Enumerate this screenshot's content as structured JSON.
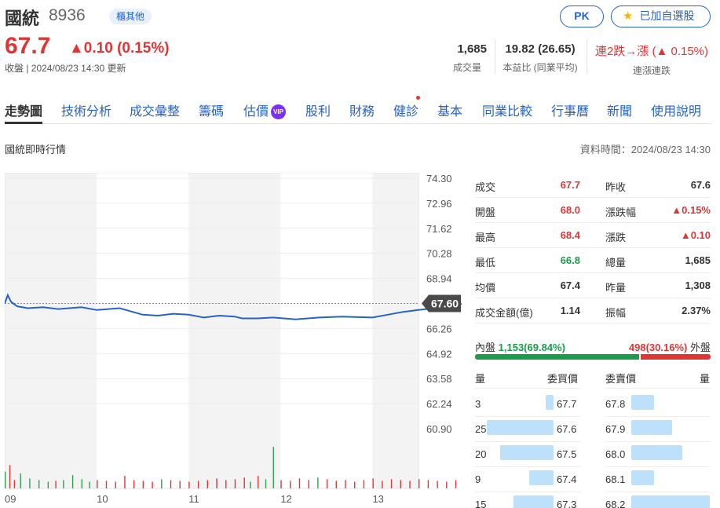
{
  "stock": {
    "name": "國統",
    "code": "8936",
    "market_tag": "櫃其他",
    "price": "67.7",
    "change": "▲0.10 (0.15%)",
    "status": "收盤 | 2024/08/23 14:30 更新",
    "color_up": "#e03535",
    "color_down": "#1a9c4a",
    "accent": "#2563c9"
  },
  "actions": {
    "pk_label": "PK",
    "fav_icon": "star-icon",
    "fav_label": "已加自選股"
  },
  "stats": [
    {
      "value": "1,685",
      "label": "成交量"
    },
    {
      "value": "19.82 (26.65)",
      "label": "本益比 (同業平均)"
    },
    {
      "value": "連2跌→漲 (▲ 0.15%)",
      "label": "連漲連跌"
    }
  ],
  "tabs": [
    "走勢圖",
    "技術分析",
    "成交彙整",
    "籌碼",
    "估價",
    "股利",
    "財務",
    "健診",
    "基本",
    "同業比較",
    "行事曆",
    "新聞",
    "使用說明"
  ],
  "vip_badge": "VIP",
  "section": {
    "title": "國統即時行情",
    "data_time": "資料時間：2024/08/23 14:30"
  },
  "chart_data": {
    "type": "line",
    "x_ticks": [
      "09",
      "10",
      "11",
      "12",
      "13"
    ],
    "y_ticks": [
      "74.30",
      "72.96",
      "71.62",
      "70.28",
      "68.94",
      "67.60",
      "66.26",
      "64.92",
      "63.58",
      "62.24",
      "60.90"
    ],
    "ylim": [
      60.9,
      74.3
    ],
    "ref_price": 67.6,
    "last_label": "67.60",
    "color": "#2563c9",
    "x_range": [
      0,
      270
    ],
    "price_series": [
      [
        0,
        67.6
      ],
      [
        2,
        68.05
      ],
      [
        4,
        67.7
      ],
      [
        8,
        67.45
      ],
      [
        15,
        67.35
      ],
      [
        25,
        67.4
      ],
      [
        35,
        67.3
      ],
      [
        50,
        67.4
      ],
      [
        60,
        67.25
      ],
      [
        75,
        67.35
      ],
      [
        90,
        67.0
      ],
      [
        100,
        66.95
      ],
      [
        110,
        67.05
      ],
      [
        120,
        67.0
      ],
      [
        130,
        66.85
      ],
      [
        140,
        66.95
      ],
      [
        150,
        66.9
      ],
      [
        155,
        66.8
      ],
      [
        165,
        66.8
      ],
      [
        175,
        66.85
      ],
      [
        190,
        66.75
      ],
      [
        205,
        66.85
      ],
      [
        220,
        66.9
      ],
      [
        240,
        66.85
      ],
      [
        250,
        67.0
      ],
      [
        260,
        67.15
      ],
      [
        270,
        67.25
      ],
      [
        280,
        67.35
      ],
      [
        290,
        67.45
      ],
      [
        300,
        67.6
      ],
      [
        310,
        67.5
      ],
      [
        320,
        67.55
      ],
      [
        330,
        67.7
      ],
      [
        345,
        67.8
      ],
      [
        358,
        67.7
      ],
      [
        362,
        67.95
      ],
      [
        370,
        67.75
      ],
      [
        385,
        67.55
      ],
      [
        400,
        67.6
      ],
      [
        420,
        67.55
      ],
      [
        440,
        67.65
      ],
      [
        450,
        67.65
      ],
      [
        455,
        67.75
      ],
      [
        470,
        67.75
      ],
      [
        480,
        67.6
      ],
      [
        490,
        67.55
      ],
      [
        500,
        67.6
      ],
      [
        515,
        67.55
      ],
      [
        527,
        67.6
      ],
      [
        540,
        67.6
      ]
    ],
    "volume_series": [
      [
        0,
        20
      ],
      [
        3,
        28
      ],
      [
        6,
        10
      ],
      [
        10,
        18
      ],
      [
        16,
        12
      ],
      [
        22,
        10
      ],
      [
        28,
        8
      ],
      [
        33,
        9
      ],
      [
        38,
        10
      ],
      [
        44,
        16
      ],
      [
        50,
        11
      ],
      [
        55,
        8
      ],
      [
        60,
        10
      ],
      [
        66,
        9
      ],
      [
        72,
        8
      ],
      [
        78,
        15
      ],
      [
        84,
        10
      ],
      [
        90,
        9
      ],
      [
        96,
        8
      ],
      [
        102,
        11
      ],
      [
        108,
        10
      ],
      [
        114,
        9
      ],
      [
        120,
        8
      ],
      [
        126,
        9
      ],
      [
        132,
        10
      ],
      [
        138,
        12
      ],
      [
        144,
        10
      ],
      [
        150,
        11
      ],
      [
        156,
        13
      ],
      [
        160,
        8
      ],
      [
        165,
        15
      ],
      [
        170,
        11
      ],
      [
        175,
        50
      ],
      [
        180,
        10
      ],
      [
        186,
        9
      ],
      [
        192,
        12
      ],
      [
        198,
        10
      ],
      [
        204,
        13
      ],
      [
        210,
        11
      ],
      [
        216,
        9
      ],
      [
        222,
        10
      ],
      [
        228,
        8
      ],
      [
        234,
        10
      ],
      [
        240,
        12
      ],
      [
        246,
        9
      ],
      [
        252,
        11
      ],
      [
        258,
        10
      ],
      [
        264,
        9
      ],
      [
        270,
        11
      ],
      [
        276,
        10
      ],
      [
        282,
        9
      ],
      [
        288,
        8
      ],
      [
        294,
        10
      ],
      [
        300,
        11
      ],
      [
        306,
        10
      ],
      [
        312,
        9
      ],
      [
        318,
        10
      ],
      [
        324,
        8
      ],
      [
        330,
        9
      ],
      [
        336,
        10
      ],
      [
        342,
        13
      ],
      [
        348,
        10
      ],
      [
        354,
        14
      ],
      [
        360,
        30
      ],
      [
        364,
        18
      ],
      [
        370,
        10
      ],
      [
        376,
        9
      ],
      [
        382,
        10
      ],
      [
        388,
        11
      ],
      [
        394,
        10
      ],
      [
        400,
        8
      ],
      [
        406,
        9
      ],
      [
        412,
        10
      ],
      [
        418,
        9
      ],
      [
        424,
        8
      ],
      [
        430,
        11
      ],
      [
        436,
        9
      ],
      [
        442,
        10
      ],
      [
        448,
        8
      ],
      [
        454,
        9
      ],
      [
        460,
        10
      ],
      [
        466,
        9
      ],
      [
        472,
        8
      ],
      [
        478,
        11
      ],
      [
        484,
        10
      ],
      [
        490,
        9
      ],
      [
        496,
        11
      ],
      [
        502,
        13
      ],
      [
        508,
        10
      ],
      [
        514,
        12
      ],
      [
        520,
        16
      ],
      [
        527,
        65
      ]
    ]
  },
  "quote": [
    {
      "l": "成交",
      "v": "67.7",
      "c": "red",
      "l2": "昨收",
      "v2": "67.6",
      "c2": "dark"
    },
    {
      "l": "開盤",
      "v": "68.0",
      "c": "red",
      "l2": "漲跌幅",
      "v2": "▲0.15%",
      "c2": "red"
    },
    {
      "l": "最高",
      "v": "68.4",
      "c": "red",
      "l2": "漲跌",
      "v2": "▲0.10",
      "c2": "red"
    },
    {
      "l": "最低",
      "v": "66.8",
      "c": "green",
      "l2": "總量",
      "v2": "1,685",
      "c2": "dark"
    },
    {
      "l": "均價",
      "v": "67.4",
      "c": "dark",
      "l2": "昨量",
      "v2": "1,308",
      "c2": "dark"
    },
    {
      "l": "成交金額(億)",
      "v": "1.14",
      "c": "dark",
      "l2": "振幅",
      "v2": "2.37%",
      "c2": "dark"
    }
  ],
  "inout": {
    "in_label": "內盤",
    "in_value": "1,153(69.84%)",
    "out_value": "498(30.16%)",
    "out_label": "外盤",
    "in_fraction": 0.6984
  },
  "orderbook": {
    "head": {
      "bid_qty": "量",
      "bid_price": "委買價",
      "ask_price": "委賣價",
      "ask_qty": "量"
    },
    "bids": [
      {
        "q": "3",
        "p": "67.7"
      },
      {
        "q": "25",
        "p": "67.6"
      },
      {
        "q": "20",
        "p": "67.5"
      },
      {
        "q": "9",
        "p": "67.4"
      },
      {
        "q": "15",
        "p": "67.3"
      }
    ],
    "asks": [
      {
        "p": "67.8",
        "q": "9"
      },
      {
        "p": "67.9",
        "q": "16"
      },
      {
        "p": "68.0",
        "q": "20"
      },
      {
        "p": "68.1",
        "q": "9"
      },
      {
        "p": "68.2",
        "q": "31"
      }
    ],
    "bar_max": 31
  }
}
